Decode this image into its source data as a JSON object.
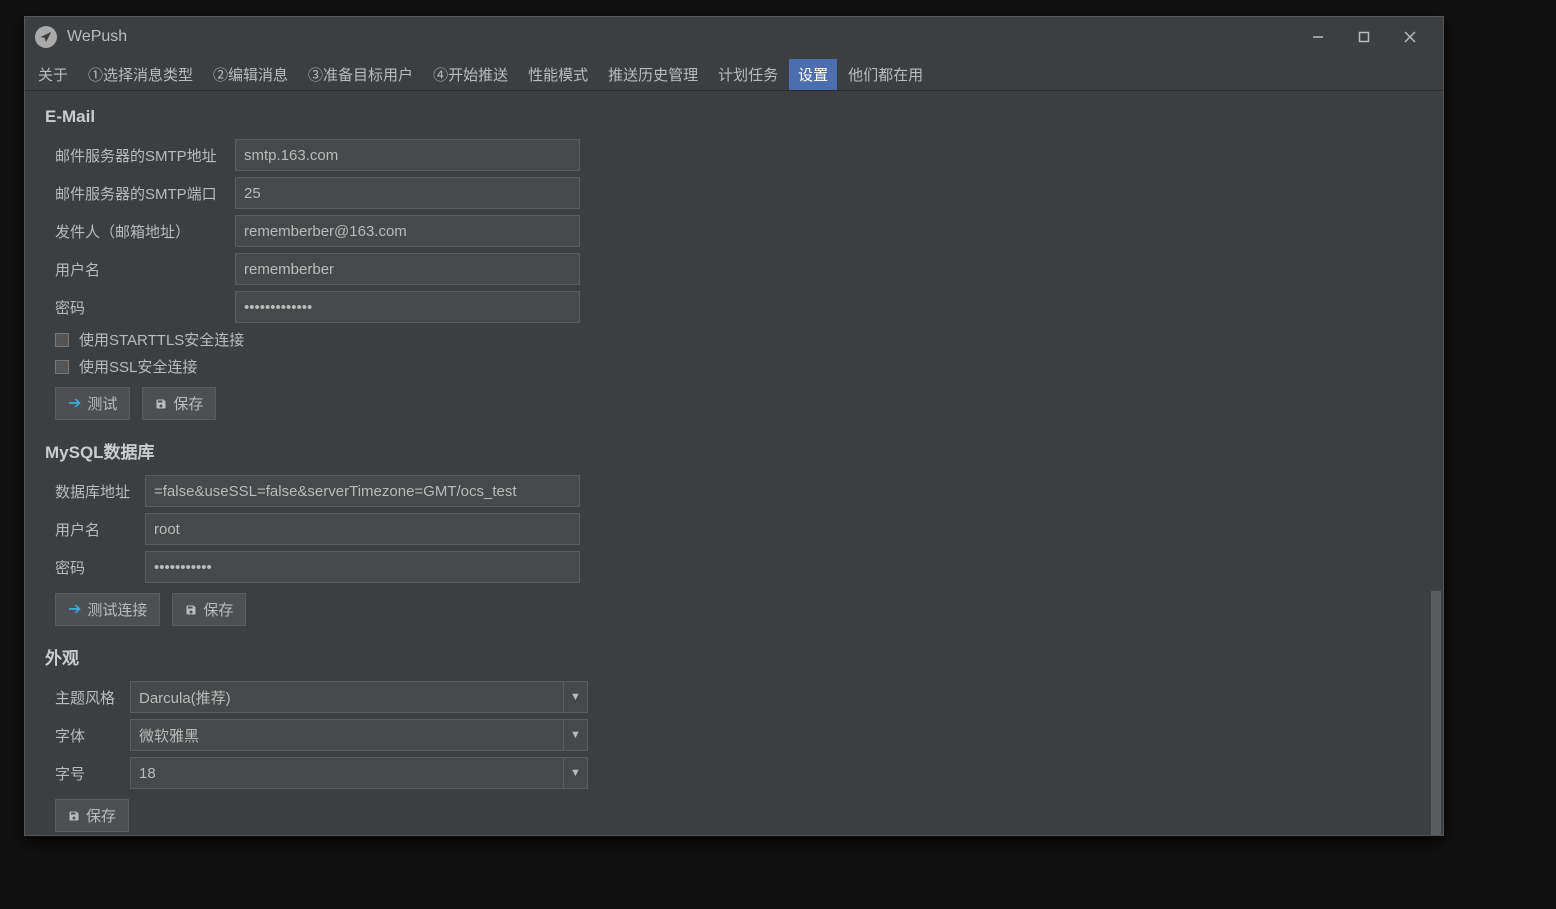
{
  "app": {
    "title": "WePush"
  },
  "tabs": [
    {
      "label": "关于"
    },
    {
      "label": "①选择消息类型"
    },
    {
      "label": "②编辑消息"
    },
    {
      "label": "③准备目标用户"
    },
    {
      "label": "④开始推送"
    },
    {
      "label": "性能模式"
    },
    {
      "label": "推送历史管理"
    },
    {
      "label": "计划任务"
    },
    {
      "label": "设置",
      "active": true
    },
    {
      "label": "他们都在用"
    }
  ],
  "sections": {
    "email": {
      "title": "E-Mail",
      "smtp_addr_label": "邮件服务器的SMTP地址",
      "smtp_addr_value": "smtp.163.com",
      "smtp_port_label": "邮件服务器的SMTP端口",
      "smtp_port_value": "25",
      "sender_label": "发件人（邮箱地址）",
      "sender_value": "rememberber@163.com",
      "user_label": "用户名",
      "user_value": "rememberber",
      "pass_label": "密码",
      "pass_value": "•••••••••••••",
      "starttls_label": "使用STARTTLS安全连接",
      "ssl_label": "使用SSL安全连接",
      "test_btn": "测试",
      "save_btn": "保存"
    },
    "mysql": {
      "title": "MySQL数据库",
      "addr_label": "数据库地址",
      "addr_value": "=false&useSSL=false&serverTimezone=GMT/ocs_test",
      "user_label": "用户名",
      "user_value": "root",
      "pass_label": "密码",
      "pass_value": "•••••••••••",
      "test_btn": "测试连接",
      "save_btn": "保存"
    },
    "appearance": {
      "title": "外观",
      "theme_label": "主题风格",
      "theme_value": "Darcula(推荐)",
      "font_label": "字体",
      "font_value": "微软雅黑",
      "size_label": "字号",
      "size_value": "18",
      "save_btn": "保存"
    }
  }
}
